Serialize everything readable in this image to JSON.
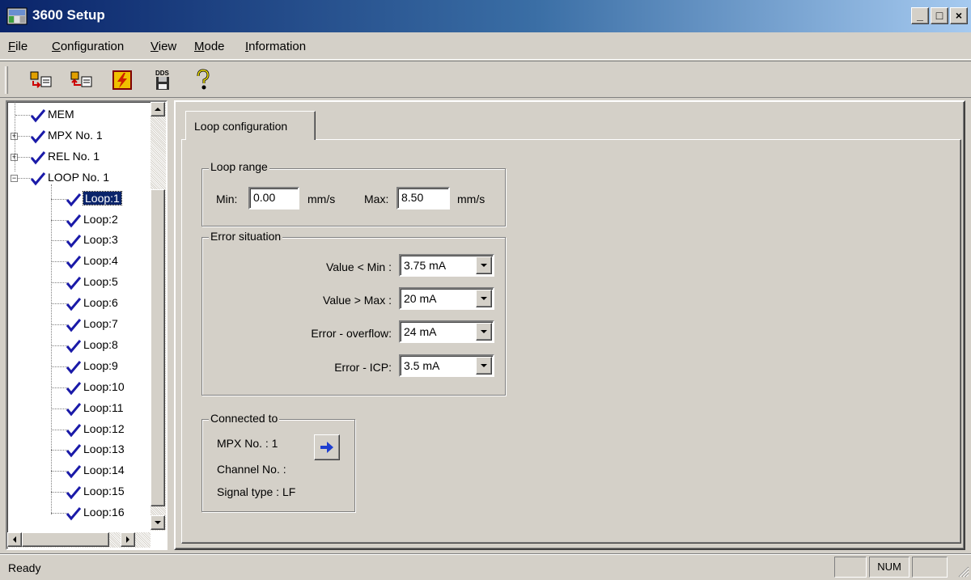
{
  "window": {
    "title": "3600 Setup",
    "buttons": {
      "minimize": "_",
      "maximize": "□",
      "close": "×"
    }
  },
  "menu": [
    {
      "key": "F",
      "rest": "ile"
    },
    {
      "key": "C",
      "rest": "onfiguration"
    },
    {
      "key": "V",
      "rest": "iew"
    },
    {
      "key": "M",
      "rest": "ode"
    },
    {
      "key": "I",
      "rest": "nformation"
    }
  ],
  "toolbar": {
    "icons": [
      "read-config-icon",
      "write-config-icon",
      "flash-icon",
      "dds-save-icon",
      "help-icon"
    ],
    "dds_text": "DDS"
  },
  "tree": {
    "items": [
      {
        "label": "MEM",
        "level": 0,
        "expander": ""
      },
      {
        "label": "MPX No. 1",
        "level": 0,
        "expander": "+"
      },
      {
        "label": "REL No. 1",
        "level": 0,
        "expander": "+"
      },
      {
        "label": "LOOP No. 1",
        "level": 0,
        "expander": "−"
      },
      {
        "label": "Loop:1",
        "level": 1,
        "selected": true
      },
      {
        "label": "Loop:2",
        "level": 1
      },
      {
        "label": "Loop:3",
        "level": 1
      },
      {
        "label": "Loop:4",
        "level": 1
      },
      {
        "label": "Loop:5",
        "level": 1
      },
      {
        "label": "Loop:6",
        "level": 1
      },
      {
        "label": "Loop:7",
        "level": 1
      },
      {
        "label": "Loop:8",
        "level": 1
      },
      {
        "label": "Loop:9",
        "level": 1
      },
      {
        "label": "Loop:10",
        "level": 1
      },
      {
        "label": "Loop:11",
        "level": 1
      },
      {
        "label": "Loop:12",
        "level": 1
      },
      {
        "label": "Loop:13",
        "level": 1
      },
      {
        "label": "Loop:14",
        "level": 1
      },
      {
        "label": "Loop:15",
        "level": 1
      },
      {
        "label": "Loop:16",
        "level": 1
      }
    ],
    "check_color": "#1a1aa8"
  },
  "tab": {
    "label": "Loop configuration"
  },
  "loop_range": {
    "title": "Loop range",
    "min_label": "Min:",
    "min_value": "0.00",
    "min_unit": "mm/s",
    "max_label": "Max:",
    "max_value": "8.50",
    "max_unit": "mm/s"
  },
  "error_situation": {
    "title": "Error situation",
    "rows": [
      {
        "label": "Value < Min :",
        "value": "3.75 mA"
      },
      {
        "label": "Value > Max :",
        "value": "20 mA"
      },
      {
        "label": "Error - overflow:",
        "value": "24 mA"
      },
      {
        "label": "Error - ICP:",
        "value": "3.5 mA"
      }
    ]
  },
  "connected_to": {
    "title": "Connected to",
    "mpx": "MPX No. : 1",
    "channel": "Channel No. :",
    "signal": "Signal type : LF"
  },
  "statusbar": {
    "text": "Ready",
    "panels": [
      "",
      "NUM",
      ""
    ]
  }
}
